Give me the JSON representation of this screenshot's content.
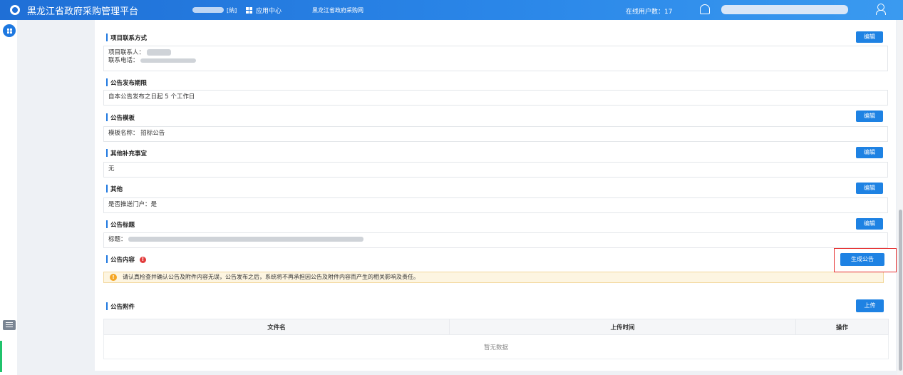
{
  "header": {
    "platform_title": "黑龙江省政府采购管理平台",
    "account_suffix": "[纳]",
    "app_center": "应用中心",
    "gov_procurement_link": "黑龙江省政府采购网",
    "online_users": "在线用户数：17"
  },
  "sections": {
    "contact": {
      "title": "项目联系方式",
      "contact_person_label": "项目联系人：",
      "phone_label": "联系电话："
    },
    "period": {
      "title": "公告发布期限",
      "text": "自本公告发布之日起 5 个工作日"
    },
    "template": {
      "title": "公告模板",
      "text": "模板名称：  招标公告"
    },
    "supplement": {
      "title": "其他补充事宜",
      "text": "无"
    },
    "other": {
      "title": "其他",
      "text": "是否推送门户：是"
    },
    "announce_title": {
      "title": "公告标题",
      "label": "标题："
    },
    "content": {
      "title": "公告内容",
      "generate_label": "生成公告",
      "notice": "请认真检查并确认公告及附件内容无误，公告发布之后，系统将不再承担因公告及附件内容而产生的相关影响及责任。"
    },
    "attachments": {
      "title": "公告附件",
      "upload_label": "上传",
      "columns": [
        "文件名",
        "上传时间",
        "操作"
      ],
      "empty_text": "暂无数据"
    }
  },
  "buttons": {
    "edit_label": "编辑"
  },
  "icons": {
    "warning_glyph": "!",
    "accent_color": "#1e82e3",
    "error_color": "#e23b3b",
    "highlight_color": "#e52d2d"
  }
}
